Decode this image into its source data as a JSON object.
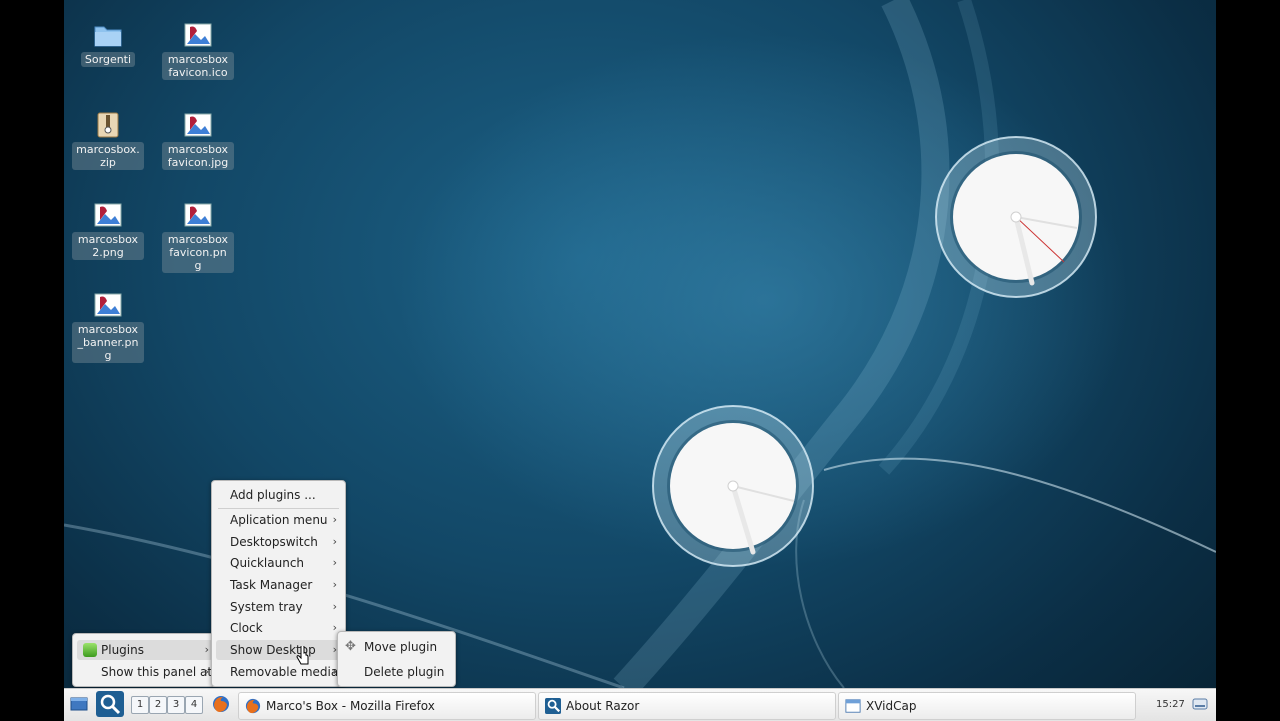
{
  "desktop_icons": [
    {
      "label": "Sorgenti",
      "icon": "folder-icon"
    },
    {
      "label": "marcosbox favicon.ico",
      "icon": "image-icon"
    },
    {
      "label": "marcosbox.zip",
      "icon": "archive-icon"
    },
    {
      "label": "marcosbox favicon.jpg",
      "icon": "image-icon"
    },
    {
      "label": "marcosbox 2.png",
      "icon": "image-icon"
    },
    {
      "label": "marcosbox favicon.png",
      "icon": "image-icon"
    },
    {
      "label": "marcosbox _banner.pn g",
      "icon": "image-icon"
    }
  ],
  "panel_menu": {
    "plugins": "Plugins",
    "show_panel_at": "Show this panel at"
  },
  "plugins_menu": {
    "add_plugins": "Add plugins ...",
    "items": [
      "Aplication menu",
      "Desktopswitch",
      "Quicklaunch",
      "Task Manager",
      "System tray",
      "Clock",
      "Show Desktop",
      "Removable media"
    ]
  },
  "plugin_actions": {
    "move": "Move plugin",
    "delete": "Delete plugin"
  },
  "taskbar": {
    "workspaces": [
      "1",
      "2",
      "3",
      "4"
    ],
    "tasks": [
      {
        "label": "Marco's Box - Mozilla Firefox",
        "icon": "firefox-icon"
      },
      {
        "label": "About Razor",
        "icon": "razor-icon"
      },
      {
        "label": "XVidCap",
        "icon": "window-icon"
      }
    ],
    "clock": "15:27"
  },
  "colors": {
    "desktop_base": "#124766",
    "menu_bg": "#f2f2f2",
    "menu_highlight": "#dcdcdc",
    "taskbar_bg": "#ececec"
  }
}
